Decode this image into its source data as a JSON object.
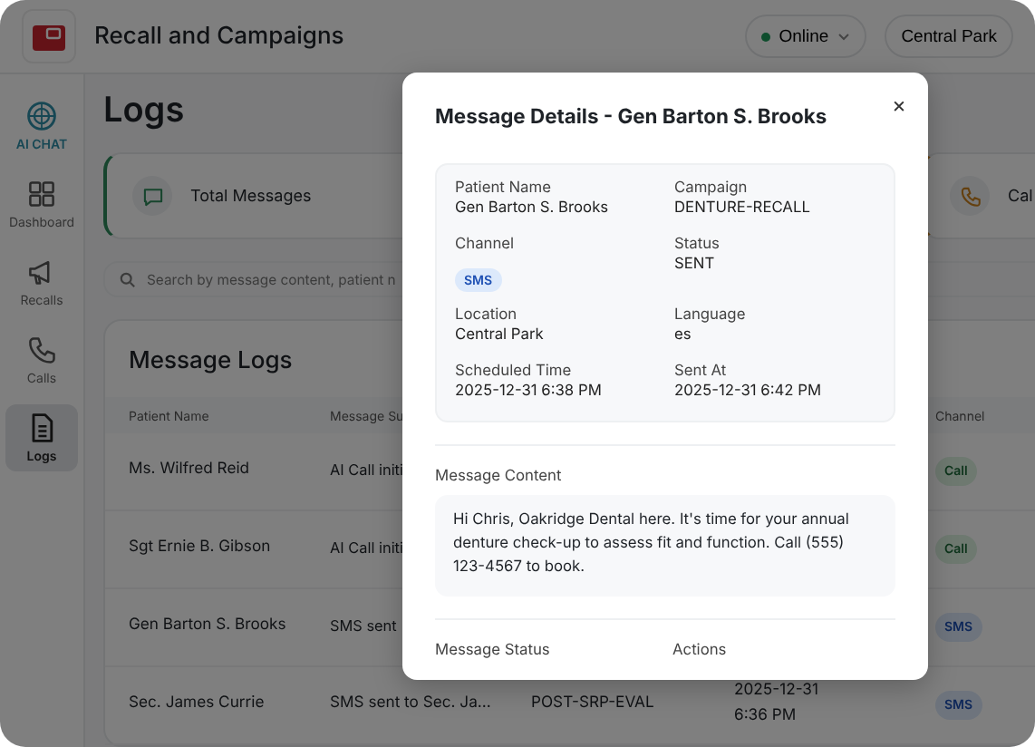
{
  "app": {
    "title": "Recall and Campaigns"
  },
  "header": {
    "status": {
      "label": "Online",
      "online": true
    },
    "location": "Central Park"
  },
  "sidebar": {
    "items": [
      {
        "label": "AI CHAT",
        "kind": "ai",
        "selected": false
      },
      {
        "label": "Dashboard",
        "kind": "grid",
        "selected": false
      },
      {
        "label": "Recalls",
        "kind": "megaphone",
        "selected": false
      },
      {
        "label": "Calls",
        "kind": "phone",
        "selected": false
      },
      {
        "label": "Logs",
        "kind": "document",
        "selected": true
      }
    ]
  },
  "page_title": "Logs",
  "stats": [
    {
      "label": "Total Messages",
      "kind": "message"
    },
    {
      "label": "Cal",
      "kind": "phone"
    }
  ],
  "search": {
    "placeholder": "Search by message content, patient n"
  },
  "logs": {
    "title": "Message Logs",
    "columns": [
      "Patient Name",
      "Message Su",
      "",
      "",
      "Channel"
    ],
    "rows": [
      {
        "patient": "Ms. Wilfred Reid",
        "message": "AI Call initi",
        "channel": "Call",
        "kind": "call"
      },
      {
        "patient": "Sgt Ernie B. Gibson",
        "message": "AI Call initi",
        "channel": "Call",
        "kind": "call"
      },
      {
        "patient": "Gen Barton S. Brooks",
        "message": "SMS sent",
        "channel": "SMS",
        "kind": "sms"
      },
      {
        "patient": "Sec. James Currie",
        "message": "SMS sent to Sec. Ja...",
        "campaign": "POST-SRP-EVAL",
        "sent": [
          "2025-12-31",
          "6:36 PM"
        ],
        "channel": "SMS",
        "kind": "sms"
      }
    ]
  },
  "modal": {
    "title": "Message Details - Gen Barton S. Brooks",
    "close": "×",
    "fields": [
      {
        "label": "Patient Name",
        "value": "Gen Barton S. Brooks",
        "kind": "text"
      },
      {
        "label": "Campaign",
        "value": "DENTURE-RECALL",
        "kind": "text"
      },
      {
        "label": "Channel",
        "value": "SMS",
        "kind": "badge"
      },
      {
        "label": "Status",
        "value": "SENT",
        "kind": "text"
      },
      {
        "label": "Location",
        "value": "Central Park",
        "kind": "text"
      },
      {
        "label": "Language",
        "value": "es",
        "kind": "text"
      },
      {
        "label": "Scheduled Time",
        "value": "2025-12-31 6:38 PM",
        "kind": "text"
      },
      {
        "label": "Sent At",
        "value": "2025-12-31 6:42 PM",
        "kind": "text"
      }
    ],
    "content_label": "Message Content",
    "content": "Hi Chris, Oakridge Dental here. It's time for your annual denture check-up to assess fit and function. Call (555) 123-4567 to book.",
    "sections": [
      "Message Status",
      "Actions"
    ]
  }
}
